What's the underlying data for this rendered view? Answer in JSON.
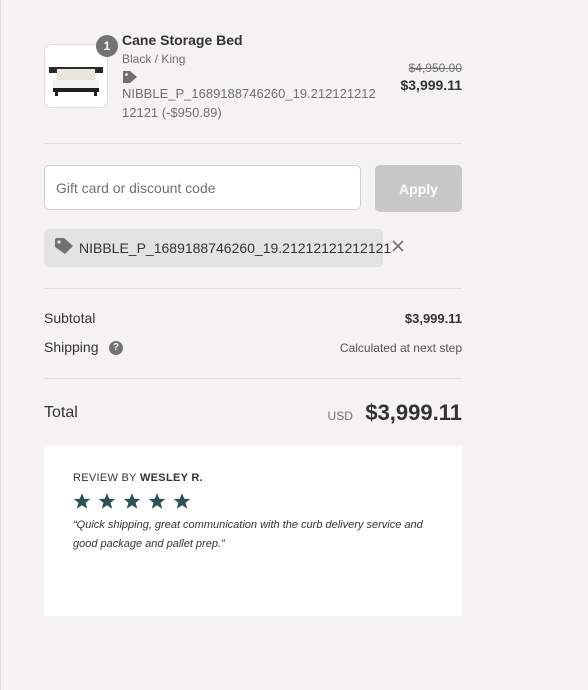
{
  "product": {
    "name": "Cane Storage Bed",
    "variant": "Black / King",
    "quantity": "1",
    "discount_text": "NIBBLE_P_1689188746260_19.21212121212121 (-$950.89)",
    "original_price": "$4,950.00",
    "price": "$3,999.11"
  },
  "discount": {
    "placeholder": "Gift card or discount code",
    "apply_label": "Apply",
    "applied_code": "NIBBLE_P_1689188746260_19.21212121212121"
  },
  "totals": {
    "subtotal_label": "Subtotal",
    "subtotal_value": "$3,999.11",
    "shipping_label": "Shipping",
    "shipping_help": "?",
    "shipping_value": "Calculated at next step",
    "total_label": "Total",
    "currency": "USD",
    "total_value": "$3,999.11"
  },
  "review": {
    "prefix": "REVIEW BY ",
    "author": "WESLEY R.",
    "rating": 5,
    "text": "“Quick shipping, great communication with the curb delivery service and good package and pallet prep.”"
  },
  "colors": {
    "background": "#f4f2f3",
    "star": "#2d5357",
    "apply_button": "#c8c8c8"
  },
  "icons": {
    "tag": "tag-icon",
    "close": "close-icon",
    "star": "star-icon",
    "help": "question-icon"
  }
}
